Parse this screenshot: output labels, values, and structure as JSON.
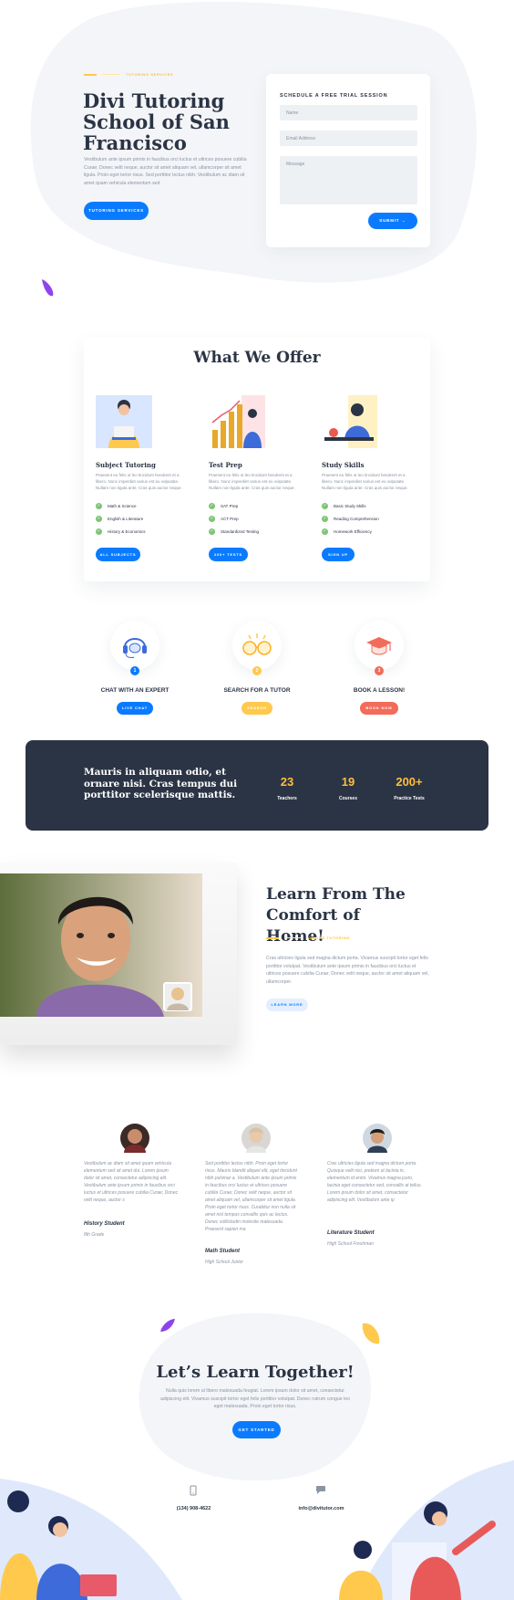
{
  "hero": {
    "eyebrow": "TUTORING SERVICES",
    "title": "Divi Tutoring School of San Francisco",
    "body": "Vestibulum ante ipsum primis in faucibus orci luctus et ultrices posuere cubilia Curae; Donec velit neque, auctor sit amet aliquam vel, ullamcorper sit amet ligula. Proin eget tortor risus. Sed porttitor lectus nibh. Vestibulum ac diam sit amet quam vehicula elementum sed",
    "cta": "TUTORING SERVICES"
  },
  "form": {
    "title": "SCHEDULE A FREE TRIAL SESSION",
    "name_placeholder": "Name",
    "email_placeholder": "Email Address",
    "message_placeholder": "Message",
    "submit": "SUBMIT →"
  },
  "offer": {
    "title": "What We Offer",
    "cards": [
      {
        "title": "Subject Tutoring",
        "text": "Praesent eu felis ut leo tincidunt hendrerit et a libero. Nunc imperdiet varius est eu vulputate. Nullam non ligula ante. Cras quis auctor neque.",
        "items": [
          "Math & Science",
          "English & Literature",
          "History & Economics"
        ],
        "button": "ALL SUBJECTS"
      },
      {
        "title": "Test Prep",
        "text": "Praesent eu felis ut leo tincidunt hendrerit et a libero. Nunc imperdiet varius est eu vulputate. Nullam non ligula ante. Cras quis auctor neque.",
        "items": [
          "SAT Prep",
          "ACT Prep",
          "Standardized Testing"
        ],
        "button": "200+ TESTS"
      },
      {
        "title": "Study Skills",
        "text": "Praesent eu felis ut leo tincidunt hendrerit et a libero. Nunc imperdiet varius est eu vulputate. Nullam non ligula ante. Cras quis auctor neque.",
        "items": [
          "Basic Study Skills",
          "Reading Comprehension",
          "Homework Efficiency"
        ],
        "button": "SIGN UP"
      }
    ]
  },
  "features": [
    {
      "title": "CHAT WITH AN EXPERT",
      "step": "1",
      "button": "LIVE CHAT",
      "color": "#0a7bff"
    },
    {
      "title": "SEARCH FOR A TUTOR",
      "step": "2",
      "button": "SEARCH",
      "color": "#ffc94d"
    },
    {
      "title": "BOOK A LESSON!",
      "step": "3",
      "button": "BOOK NOW",
      "color": "#f26b5b"
    }
  ],
  "stats": {
    "quote": "Mauris in aliquam odio, et ornare nisi. Cras tempus dui porttitor scelerisque mattis.",
    "items": [
      {
        "value": "23",
        "label": "Teachers"
      },
      {
        "value": "19",
        "label": "Courses"
      },
      {
        "value": "200+",
        "label": "Practice Tests"
      }
    ]
  },
  "online": {
    "title": "Learn From The Comfort of Home!",
    "eyebrow": "ONLINE TUTORING",
    "body": "Cras ultricies ligula sed magna dictum porta. Vivamus suscipit tortor eget felis porttitor volutpat. Vestibulum ante ipsum primis in faucibus orci luctus et ultrices posuere cubilia Curae; Donec velit neque, auctor sit amet aliquam vel, ullamcorper.",
    "button": "LEARN MORE"
  },
  "testimonials": [
    {
      "text": "Vestibulum ac diam sit amet quam vehicula elementum sed sit amet dui. Lorem ipsum dolor sit amet, consectetur adipiscing elit. Vestibulum ante ipsum primis in faucibus orci luctus et ultrices posuere cubilia Curae; Donec velit neque, auctor s",
      "name": "History Student",
      "role": "8th Grade"
    },
    {
      "text": "Sed porttitor lectus nibh. Proin eget tortor risus. Mauris blandit aliquet elit, eget tincidunt nibh pulvinar a. Vestibulum ante ipsum primis in faucibus orci luctus et ultrices posuere cubilia Curae; Donec velit neque, auctor sit amet aliquam vel, ullamcorper sit amet ligula. Proin eget tortor risus. Curabitur non nulla sit amet nisl tempus convallis quis ac lectus. Donec sollicitudin molestie malesuada. Praesent sapien ma",
      "name": "Math Student",
      "role": "High School Junior"
    },
    {
      "text": "Cras ultricies ligula sed magna dictum porta. Quisque velit nisi, pretium ut lacinia in, elementum id enim. Vivamus magna justo, lacinia eget consectetur sed, convallis at tellus. Lorem ipsum dolor sit amet, consectetur adipiscing elit. Vestibulum ante ip",
      "name": "Literature Student",
      "role": "High School Freshman"
    }
  ],
  "cta": {
    "title": "Let’s Learn Together!",
    "body": "Nulla quis lorem ut libero malesuada feugiat. Lorem ipsum dolor sit amet, consectetur adipiscing elit. Vivamus suscipit tortor eget felis porttitor volutpat. Donec rutrum congue leo eget malesuada. Proin eget tortor risus.",
    "button": "GET STARTED"
  },
  "contact": {
    "phone": "(134) 908-4622",
    "email": "info@divitutor.com",
    "phone_icon": "phone-icon",
    "email_icon": "chat-bubble-icon"
  }
}
